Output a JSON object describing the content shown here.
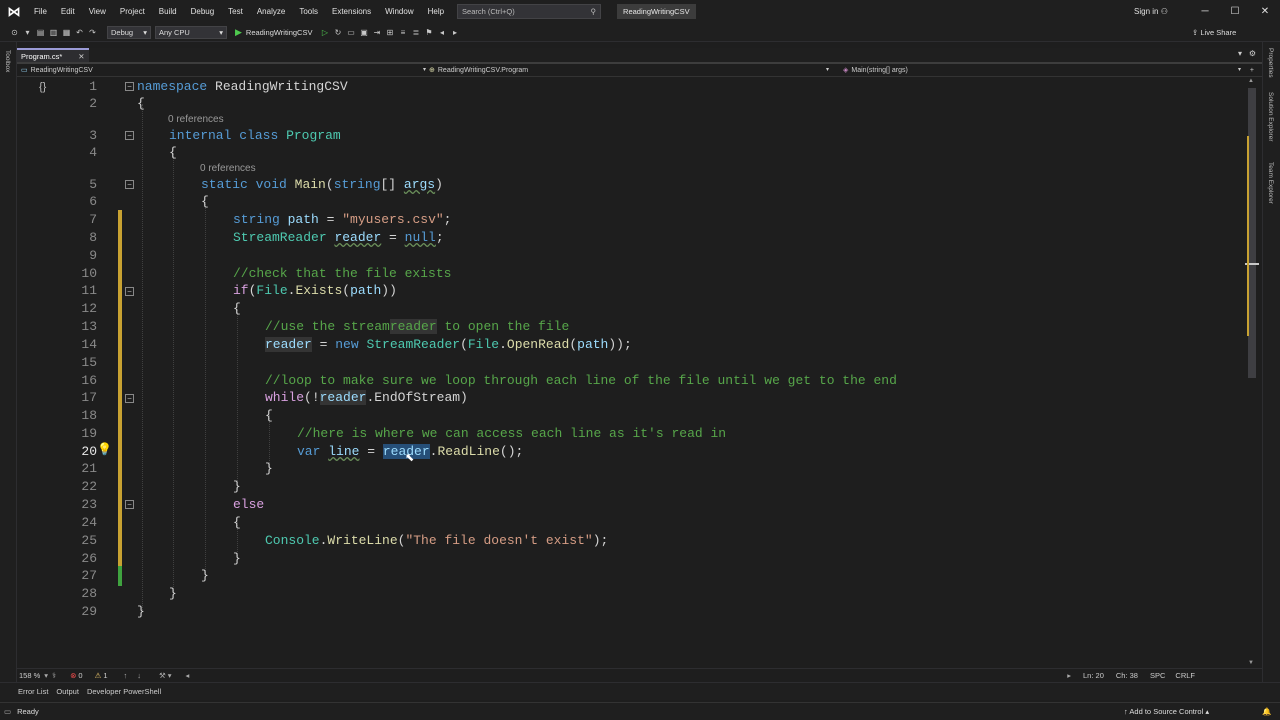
{
  "menubar": {
    "items": [
      "File",
      "Edit",
      "View",
      "Project",
      "Build",
      "Debug",
      "Test",
      "Analyze",
      "Tools",
      "Extensions",
      "Window",
      "Help"
    ],
    "search_placeholder": "Search (Ctrl+Q)",
    "solution_title": "ReadingWritingCSV",
    "sign_in": "Sign in"
  },
  "toolbar": {
    "configuration": "Debug",
    "platform": "Any CPU",
    "run_target": "ReadingWritingCSV",
    "live_share": "Live Share"
  },
  "side_panels": {
    "left": [
      "Toolbox"
    ],
    "right": [
      "Properties",
      "Solution Explorer",
      "Team Explorer"
    ]
  },
  "tab": {
    "label": "Program.cs*"
  },
  "navbar": {
    "project": "ReadingWritingCSV",
    "class": "ReadingWritingCSV.Program",
    "member": "Main(string[] args)"
  },
  "editor": {
    "current_line": 20,
    "references_label": "0 references",
    "lines": [
      {
        "n": "1",
        "t": "namespace ReadingWritingCSV"
      },
      {
        "n": "2",
        "t": "{"
      },
      {
        "n": "3",
        "t": "internal class Program"
      },
      {
        "n": "4",
        "t": "{"
      },
      {
        "n": "5",
        "t": "static void Main(string[] args)"
      },
      {
        "n": "6",
        "t": "{"
      },
      {
        "n": "7",
        "t": "string path = \"myusers.csv\";"
      },
      {
        "n": "8",
        "t": "StreamReader reader = null;"
      },
      {
        "n": "9",
        "t": ""
      },
      {
        "n": "10",
        "t": "//check that the file exists"
      },
      {
        "n": "11",
        "t": "if(File.Exists(path))"
      },
      {
        "n": "12",
        "t": "{"
      },
      {
        "n": "13",
        "t": "//use the streamreader to open the file"
      },
      {
        "n": "14",
        "t": "reader = new StreamReader(File.OpenRead(path));"
      },
      {
        "n": "15",
        "t": ""
      },
      {
        "n": "16",
        "t": "//loop to make sure we loop through each line of the file until we get to the end"
      },
      {
        "n": "17",
        "t": "while(!reader.EndOfStream)"
      },
      {
        "n": "18",
        "t": "{"
      },
      {
        "n": "19",
        "t": "//here is where we can access each line as it's read in"
      },
      {
        "n": "20",
        "t": "var line = reader.ReadLine();"
      },
      {
        "n": "21",
        "t": "}"
      },
      {
        "n": "22",
        "t": "}"
      },
      {
        "n": "23",
        "t": "else"
      },
      {
        "n": "24",
        "t": "{"
      },
      {
        "n": "25",
        "t": "Console.WriteLine(\"The file doesn't exist\");"
      },
      {
        "n": "26",
        "t": "}"
      },
      {
        "n": "27",
        "t": "}"
      },
      {
        "n": "28",
        "t": "}"
      },
      {
        "n": "29",
        "t": "}"
      }
    ]
  },
  "bottom_bar": {
    "zoom": "158 %",
    "errors": "0",
    "warnings": "1",
    "ln": "Ln: 20",
    "ch": "Ch: 38",
    "whitespace": "SPC",
    "line_endings": "CRLF"
  },
  "bottom_tabs": [
    "Error List",
    "Output",
    "Developer PowerShell"
  ],
  "status": {
    "text": "Ready",
    "source_control": "Add to Source Control"
  },
  "colors": {
    "keyword": "#569cd6",
    "type": "#4ec9b0",
    "method": "#dcdcaa",
    "string": "#d69d85",
    "comment": "#57a64a",
    "selection": "#264f78"
  }
}
